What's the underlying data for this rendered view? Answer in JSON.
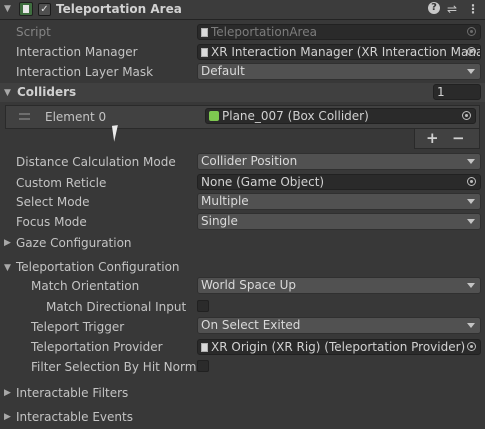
{
  "header": {
    "title": "Teleportation Area",
    "enabled": true
  },
  "rows": {
    "script": {
      "label": "Script",
      "value": "TeleportationArea"
    },
    "interaction_manager": {
      "label": "Interaction Manager",
      "value": "XR Interaction Manager (XR Interaction Mana"
    },
    "layer_mask": {
      "label": "Interaction Layer Mask",
      "value": "Default"
    },
    "colliders": {
      "label": "Colliders",
      "count": "1"
    },
    "element0": {
      "label": "Element 0",
      "value": "Plane_007 (Box Collider)"
    },
    "distance_mode": {
      "label": "Distance Calculation Mode",
      "value": "Collider Position"
    },
    "custom_reticle": {
      "label": "Custom Reticle",
      "value": "None (Game Object)"
    },
    "select_mode": {
      "label": "Select Mode",
      "value": "Multiple"
    },
    "focus_mode": {
      "label": "Focus Mode",
      "value": "Single"
    },
    "gaze_configuration": {
      "label": "Gaze Configuration"
    },
    "teleport_configuration": {
      "label": "Teleportation Configuration"
    },
    "match_orientation": {
      "label": "Match Orientation",
      "value": "World Space Up"
    },
    "match_directional": {
      "label": "Match Directional Input",
      "checked": false
    },
    "teleport_trigger": {
      "label": "Teleport Trigger",
      "value": "On Select Exited"
    },
    "teleport_provider": {
      "label": "Teleportation Provider",
      "value": "XR Origin (XR Rig) (Teleportation Provider)"
    },
    "filter_selection": {
      "label": "Filter Selection By Hit Normal",
      "checked": false
    },
    "interactable_filters": {
      "label": "Interactable Filters"
    },
    "interactable_events": {
      "label": "Interactable Events"
    }
  },
  "list_buttons": {
    "add": "+",
    "remove": "−"
  }
}
